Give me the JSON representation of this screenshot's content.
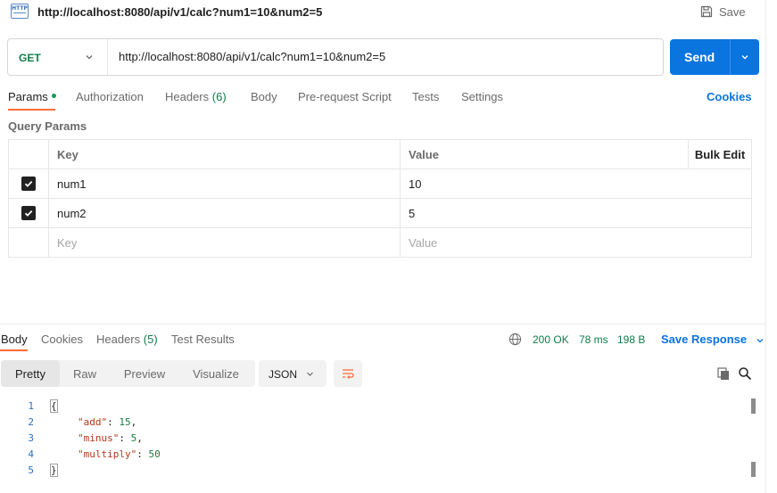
{
  "window": {
    "title_url": "http://localhost:8080/api/v1/calc?num1=10&num2=5",
    "http_icon_text": "HTTP",
    "save_label": "Save"
  },
  "request": {
    "method": "GET",
    "url": "http://localhost:8080/api/v1/calc?num1=10&num2=5",
    "send_label": "Send"
  },
  "request_tabs": {
    "params": "Params",
    "authorization": "Authorization",
    "headers": "Headers",
    "headers_count": "(6)",
    "body": "Body",
    "prerequest": "Pre-request Script",
    "tests": "Tests",
    "settings": "Settings",
    "cookies": "Cookies"
  },
  "query_params": {
    "title": "Query Params",
    "headers": {
      "key": "Key",
      "value": "Value",
      "bulk_edit": "Bulk Edit"
    },
    "rows": [
      {
        "checked": true,
        "key": "num1",
        "value": "10"
      },
      {
        "checked": true,
        "key": "num2",
        "value": "5"
      }
    ],
    "placeholder": {
      "key": "Key",
      "value": "Value"
    }
  },
  "response": {
    "tabs": {
      "body": "Body",
      "cookies": "Cookies",
      "headers": "Headers",
      "headers_count": "(5)",
      "test_results": "Test Results"
    },
    "status": "200 OK",
    "time": "78 ms",
    "size": "198 B",
    "save_response": "Save Response",
    "views": [
      "Pretty",
      "Raw",
      "Preview",
      "Visualize"
    ],
    "active_view": "Pretty",
    "format": "JSON",
    "lines": [
      {
        "num": "1",
        "text": "{"
      },
      {
        "num": "2",
        "key": "\"add\"",
        "value": "15",
        "tail": ","
      },
      {
        "num": "3",
        "key": "\"minus\"",
        "value": "5",
        "tail": ","
      },
      {
        "num": "4",
        "key": "\"multiply\"",
        "value": "50",
        "tail": ""
      },
      {
        "num": "5",
        "text": "}"
      }
    ]
  },
  "colors": {
    "accent": "#ff6c37",
    "primary": "#0a74df",
    "success": "#0f7d4b"
  }
}
